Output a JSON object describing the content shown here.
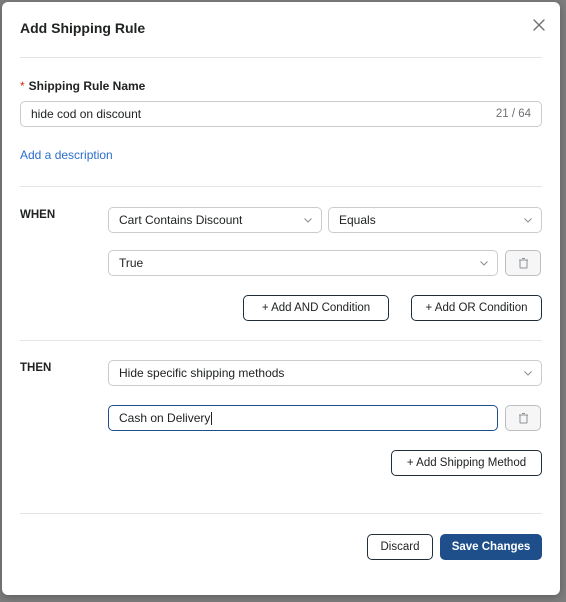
{
  "modal": {
    "title": "Add Shipping Rule",
    "close_icon": "close-icon"
  },
  "name_field": {
    "required_marker": "*",
    "label": "Shipping Rule Name",
    "value": "hide cod on discount",
    "char_count": "21 / 64"
  },
  "description_link": "Add a description",
  "when": {
    "label": "WHEN",
    "condition_field": "Cart Contains Discount",
    "operator": "Equals",
    "value": "True",
    "delete_icon": "trash-icon",
    "add_and_label": "+ Add AND Condition",
    "add_or_label": "+ Add OR Condition"
  },
  "then": {
    "label": "THEN",
    "action": "Hide specific shipping methods",
    "method_value": "Cash on Delivery",
    "delete_icon": "trash-icon",
    "add_method_label": "+ Add Shipping Method"
  },
  "footer": {
    "discard_label": "Discard",
    "save_label": "Save Changes"
  },
  "colors": {
    "primary": "#1f4f8b",
    "link": "#2c6ecb",
    "required": "#d72c0d"
  }
}
